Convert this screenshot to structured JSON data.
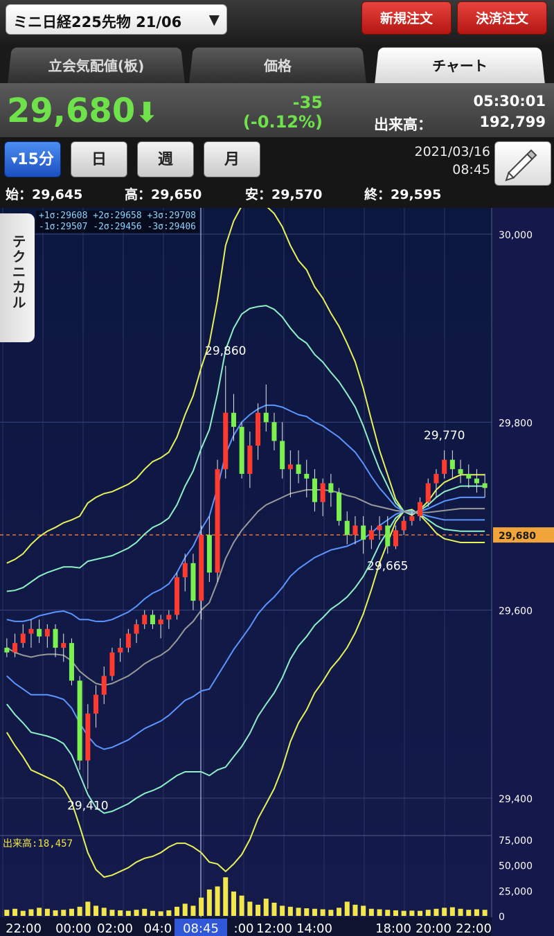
{
  "header": {
    "symbol": "ミニ日経225先物 21/06",
    "dropdown_arrow": "▼",
    "new_order": "新規注文",
    "settle_order": "決済注文"
  },
  "tabs": [
    {
      "label": "立会気配値(板)",
      "active": false
    },
    {
      "label": "価格",
      "active": false
    },
    {
      "label": "チャート",
      "active": true
    }
  ],
  "price": {
    "last": "29,680",
    "direction": "down",
    "direction_glyph": "⬇",
    "change": "-35",
    "change_pct": "(-0.12%)",
    "time": "05:30:01",
    "volume_label": "出来高：",
    "volume": "192,799",
    "color_up_down": "#6fe24b"
  },
  "period_buttons": [
    {
      "label": "15分",
      "active": true
    },
    {
      "label": "日",
      "active": false
    },
    {
      "label": "週",
      "active": false
    },
    {
      "label": "月",
      "active": false
    }
  ],
  "chart_date": "2021/03/16",
  "chart_time": "08:45",
  "draw_icon": "pencil-icon",
  "ohlc": {
    "open": "始：29,645",
    "high": "高：29,650",
    "low": "安：29,570",
    "close": "終：29,595"
  },
  "technical_tab": "テクニカル",
  "bb_legend": {
    "line1": "+1σ:29608 +2σ:29658 +3σ:29708",
    "line2": "-1σ:29507 -2σ:29456 -3σ:29406"
  },
  "chart_data": {
    "type": "candlestick",
    "price_axis": {
      "min": 29400,
      "max": 30000,
      "ticks": [
        "30,000",
        "29,800",
        "29,600",
        "29,400"
      ]
    },
    "current_price_label": "29,680",
    "current_price": 29680,
    "annotations": [
      {
        "text": "29,860",
        "price": 29860,
        "bar": 27
      },
      {
        "text": "29,770",
        "price": 29770,
        "bar": 54
      },
      {
        "text": "29,665",
        "price": 29665,
        "bar": 47
      },
      {
        "text": "29,410",
        "price": 29410,
        "bar": 10
      }
    ],
    "time_labels": [
      "22:00",
      "00:00",
      "02:00",
      "04:0",
      "08:45",
      ":00",
      "12:00",
      "14:00",
      "18:00",
      "20:00",
      "22:00"
    ],
    "highlighted_time": "08:45",
    "volume_axis": {
      "max": 75000,
      "ticks": [
        "75,000",
        "50,000",
        "25,000",
        "0"
      ]
    },
    "volume_label": "出来高:18,457",
    "candles": [
      {
        "o": 29560,
        "h": 29570,
        "l": 29550,
        "c": 29555
      },
      {
        "o": 29555,
        "h": 29575,
        "l": 29550,
        "c": 29565
      },
      {
        "o": 29565,
        "h": 29585,
        "l": 29560,
        "c": 29575
      },
      {
        "o": 29575,
        "h": 29590,
        "l": 29560,
        "c": 29580
      },
      {
        "o": 29580,
        "h": 29590,
        "l": 29565,
        "c": 29572
      },
      {
        "o": 29572,
        "h": 29585,
        "l": 29560,
        "c": 29580
      },
      {
        "o": 29580,
        "h": 29585,
        "l": 29550,
        "c": 29560
      },
      {
        "o": 29560,
        "h": 29575,
        "l": 29545,
        "c": 29565
      },
      {
        "o": 29565,
        "h": 29570,
        "l": 29520,
        "c": 29525
      },
      {
        "o": 29525,
        "h": 29530,
        "l": 29430,
        "c": 29440
      },
      {
        "o": 29440,
        "h": 29500,
        "l": 29410,
        "c": 29490
      },
      {
        "o": 29490,
        "h": 29520,
        "l": 29475,
        "c": 29510
      },
      {
        "o": 29510,
        "h": 29540,
        "l": 29500,
        "c": 29530
      },
      {
        "o": 29530,
        "h": 29560,
        "l": 29525,
        "c": 29555
      },
      {
        "o": 29555,
        "h": 29570,
        "l": 29545,
        "c": 29560
      },
      {
        "o": 29560,
        "h": 29580,
        "l": 29555,
        "c": 29575
      },
      {
        "o": 29575,
        "h": 29590,
        "l": 29565,
        "c": 29585
      },
      {
        "o": 29585,
        "h": 29600,
        "l": 29580,
        "c": 29595
      },
      {
        "o": 29595,
        "h": 29600,
        "l": 29580,
        "c": 29585
      },
      {
        "o": 29585,
        "h": 29595,
        "l": 29570,
        "c": 29590
      },
      {
        "o": 29590,
        "h": 29600,
        "l": 29580,
        "c": 29595
      },
      {
        "o": 29595,
        "h": 29640,
        "l": 29590,
        "c": 29635
      },
      {
        "o": 29635,
        "h": 29660,
        "l": 29620,
        "c": 29650
      },
      {
        "o": 29650,
        "h": 29660,
        "l": 29600,
        "c": 29610
      },
      {
        "o": 29610,
        "h": 29690,
        "l": 29590,
        "c": 29680
      },
      {
        "o": 29680,
        "h": 29700,
        "l": 29630,
        "c": 29640
      },
      {
        "o": 29640,
        "h": 29760,
        "l": 29630,
        "c": 29750
      },
      {
        "o": 29750,
        "h": 29860,
        "l": 29740,
        "c": 29810
      },
      {
        "o": 29810,
        "h": 29830,
        "l": 29780,
        "c": 29795
      },
      {
        "o": 29795,
        "h": 29800,
        "l": 29740,
        "c": 29745
      },
      {
        "o": 29745,
        "h": 29790,
        "l": 29730,
        "c": 29775
      },
      {
        "o": 29775,
        "h": 29820,
        "l": 29760,
        "c": 29810
      },
      {
        "o": 29810,
        "h": 29840,
        "l": 29790,
        "c": 29800
      },
      {
        "o": 29800,
        "h": 29810,
        "l": 29770,
        "c": 29780
      },
      {
        "o": 29780,
        "h": 29800,
        "l": 29740,
        "c": 29750
      },
      {
        "o": 29750,
        "h": 29770,
        "l": 29720,
        "c": 29755
      },
      {
        "o": 29755,
        "h": 29770,
        "l": 29735,
        "c": 29745
      },
      {
        "o": 29745,
        "h": 29760,
        "l": 29720,
        "c": 29740
      },
      {
        "o": 29740,
        "h": 29750,
        "l": 29705,
        "c": 29715
      },
      {
        "o": 29715,
        "h": 29740,
        "l": 29700,
        "c": 29735
      },
      {
        "o": 29735,
        "h": 29745,
        "l": 29710,
        "c": 29725
      },
      {
        "o": 29725,
        "h": 29730,
        "l": 29690,
        "c": 29695
      },
      {
        "o": 29695,
        "h": 29705,
        "l": 29670,
        "c": 29680
      },
      {
        "o": 29680,
        "h": 29700,
        "l": 29670,
        "c": 29690
      },
      {
        "o": 29690,
        "h": 29700,
        "l": 29660,
        "c": 29675
      },
      {
        "o": 29675,
        "h": 29690,
        "l": 29665,
        "c": 29685
      },
      {
        "o": 29685,
        "h": 29700,
        "l": 29675,
        "c": 29690
      },
      {
        "o": 29690,
        "h": 29700,
        "l": 29660,
        "c": 29668
      },
      {
        "o": 29668,
        "h": 29690,
        "l": 29665,
        "c": 29685
      },
      {
        "o": 29685,
        "h": 29700,
        "l": 29680,
        "c": 29695
      },
      {
        "o": 29695,
        "h": 29705,
        "l": 29690,
        "c": 29700
      },
      {
        "o": 29700,
        "h": 29720,
        "l": 29695,
        "c": 29715
      },
      {
        "o": 29715,
        "h": 29740,
        "l": 29710,
        "c": 29735
      },
      {
        "o": 29735,
        "h": 29750,
        "l": 29720,
        "c": 29745
      },
      {
        "o": 29745,
        "h": 29770,
        "l": 29740,
        "c": 29760
      },
      {
        "o": 29760,
        "h": 29770,
        "l": 29740,
        "c": 29750
      },
      {
        "o": 29750,
        "h": 29760,
        "l": 29735,
        "c": 29745
      },
      {
        "o": 29745,
        "h": 29755,
        "l": 29730,
        "c": 29740
      },
      {
        "o": 29740,
        "h": 29750,
        "l": 29725,
        "c": 29735
      },
      {
        "o": 29735,
        "h": 29745,
        "l": 29720,
        "c": 29730
      }
    ],
    "volumes": [
      6000,
      7000,
      5000,
      6500,
      8000,
      7000,
      5500,
      6000,
      7000,
      9000,
      14000,
      10000,
      8000,
      6000,
      5500,
      5000,
      6000,
      7000,
      5000,
      4500,
      5500,
      9000,
      12000,
      10000,
      18000,
      26000,
      29000,
      38000,
      24000,
      20000,
      14000,
      11000,
      17000,
      13000,
      10000,
      9000,
      8000,
      7500,
      7000,
      6500,
      6000,
      8000,
      14000,
      11000,
      10000,
      7000,
      6500,
      6000,
      5500,
      5000,
      5200,
      5000,
      6000,
      7000,
      8000,
      8500,
      7000,
      6000,
      6500,
      6000
    ],
    "bands": {
      "sma": [
        29560,
        29555,
        29552,
        29550,
        29552,
        29553,
        29553,
        29552,
        29546,
        29535,
        29528,
        29522,
        29520,
        29522,
        29526,
        29530,
        29536,
        29543,
        29548,
        29552,
        29558,
        29568,
        29580,
        29588,
        29600,
        29608,
        29630,
        29655,
        29672,
        29685,
        29695,
        29705,
        29712,
        29716,
        29720,
        29724,
        29726,
        29728,
        29728,
        29728,
        29727,
        29725,
        29722,
        29720,
        29716,
        29712,
        29710,
        29708,
        29706,
        29705,
        29704,
        29704,
        29704,
        29705,
        29706,
        29707,
        29708,
        29708,
        29708,
        29708
      ],
      "p1": [
        29590,
        29588,
        29588,
        29590,
        29594,
        29596,
        29598,
        29599,
        29596,
        29590,
        29590,
        29588,
        29588,
        29590,
        29594,
        29598,
        29604,
        29612,
        29618,
        29622,
        29628,
        29640,
        29656,
        29668,
        29686,
        29700,
        29730,
        29766,
        29786,
        29800,
        29808,
        29814,
        29818,
        29818,
        29816,
        29812,
        29808,
        29806,
        29800,
        29796,
        29790,
        29784,
        29776,
        29768,
        29756,
        29742,
        29730,
        29720,
        29710,
        29705,
        29703,
        29705,
        29708,
        29712,
        29716,
        29718,
        29720,
        29720,
        29720,
        29720
      ],
      "p2": [
        29620,
        29621,
        29624,
        29630,
        29636,
        29640,
        29643,
        29646,
        29646,
        29645,
        29652,
        29654,
        29656,
        29658,
        29662,
        29666,
        29672,
        29681,
        29688,
        29692,
        29698,
        29712,
        29732,
        29748,
        29772,
        29792,
        29830,
        29877,
        29900,
        29915,
        29921,
        29923,
        29924,
        29920,
        29912,
        29900,
        29890,
        29884,
        29872,
        29864,
        29853,
        29843,
        29830,
        29816,
        29796,
        29772,
        29750,
        29732,
        29714,
        29705,
        29702,
        29706,
        29712,
        29720,
        29726,
        29729,
        29732,
        29732,
        29732,
        29732
      ],
      "p3": [
        29650,
        29654,
        29660,
        29670,
        29678,
        29684,
        29688,
        29693,
        29696,
        29700,
        29714,
        29720,
        29724,
        29726,
        29730,
        29734,
        29740,
        29750,
        29758,
        29762,
        29768,
        29784,
        29808,
        29828,
        29858,
        29884,
        29930,
        29988,
        30014,
        30030,
        30034,
        30032,
        30030,
        30022,
        30008,
        29988,
        29972,
        29962,
        29944,
        29932,
        29916,
        29902,
        29884,
        29864,
        29836,
        29802,
        29770,
        29744,
        29718,
        29705,
        29701,
        29707,
        29716,
        29728,
        29736,
        29740,
        29744,
        29744,
        29744,
        29744
      ],
      "m1": [
        29530,
        29522,
        29516,
        29510,
        29510,
        29510,
        29508,
        29505,
        29496,
        29480,
        29466,
        29456,
        29452,
        29454,
        29458,
        29462,
        29468,
        29474,
        29478,
        29482,
        29488,
        29496,
        29504,
        29508,
        29514,
        29516,
        29530,
        29544,
        29558,
        29570,
        29582,
        29596,
        29606,
        29614,
        29624,
        29636,
        29644,
        29650,
        29656,
        29660,
        29664,
        29666,
        29668,
        29672,
        29676,
        29682,
        29690,
        29696,
        29702,
        29705,
        29705,
        29703,
        29700,
        29698,
        29696,
        29696,
        29696,
        29696,
        29696,
        29696
      ],
      "m2": [
        29500,
        29489,
        29480,
        29470,
        29468,
        29466,
        29463,
        29458,
        29446,
        29425,
        29404,
        29390,
        29384,
        29386,
        29390,
        29394,
        29400,
        29405,
        29408,
        29412,
        29418,
        29424,
        29428,
        29428,
        29428,
        29424,
        29430,
        29433,
        29444,
        29455,
        29469,
        29487,
        29500,
        29512,
        29528,
        29548,
        29562,
        29572,
        29584,
        29592,
        29601,
        29607,
        29614,
        29624,
        29636,
        29652,
        29670,
        29684,
        29698,
        29705,
        29706,
        29702,
        29696,
        29690,
        29686,
        29685,
        29684,
        29684,
        29684,
        29684
      ],
      "m3": [
        29470,
        29456,
        29444,
        29430,
        29426,
        29422,
        29418,
        29411,
        29396,
        29370,
        29342,
        29324,
        29316,
        29318,
        29322,
        29326,
        29332,
        29336,
        29338,
        29342,
        29348,
        29352,
        29352,
        29348,
        29342,
        29332,
        29330,
        29322,
        29330,
        29340,
        29356,
        29378,
        29394,
        29410,
        29432,
        29460,
        29480,
        29494,
        29512,
        29524,
        29538,
        29548,
        29560,
        29576,
        29596,
        29622,
        29650,
        29672,
        29694,
        29705,
        29707,
        29701,
        29692,
        29682,
        29676,
        29674,
        29672,
        29672,
        29672,
        29672
      ]
    }
  }
}
